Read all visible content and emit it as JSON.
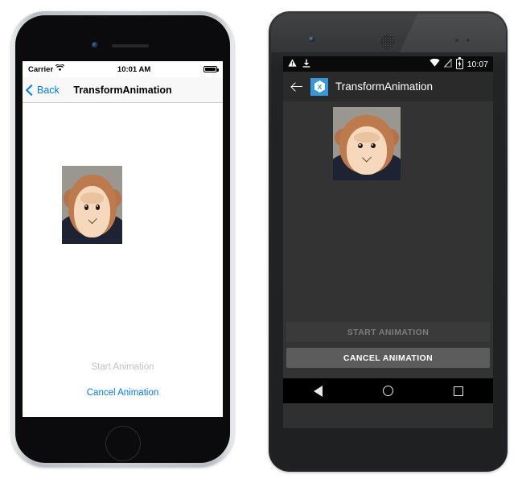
{
  "ios": {
    "status": {
      "carrier": "Carrier",
      "wifi_icon": "wifi-icon",
      "time": "10:01 AM",
      "battery_icon": "battery-full-icon"
    },
    "nav": {
      "back_label": "Back",
      "back_icon": "chevron-left-icon",
      "title": "TransformAnimation",
      "accent": "#007AFF"
    },
    "content": {
      "image_name": "monkey-plush-photo"
    },
    "buttons": [
      {
        "label": "Start Animation",
        "state": "disabled",
        "color": "#c2c2c6"
      },
      {
        "label": "Cancel Animation",
        "state": "enabled",
        "color": "#007AFF"
      }
    ],
    "hardware": {
      "camera": "front-camera",
      "speaker": "earpiece-speaker",
      "home": "home-button"
    }
  },
  "android": {
    "status": {
      "warning_icon": "warning-triangle-icon",
      "download_icon": "download-icon",
      "wifi_icon": "wifi-icon",
      "signal_icon": "signal-off-icon",
      "battery_icon": "battery-charging-icon",
      "time": "10:07"
    },
    "appbar": {
      "back_icon": "arrow-back-icon",
      "logo_icon": "xamarin-logo-icon",
      "logo_letter": "X",
      "title": "TransformAnimation",
      "logo_color": "#3498db"
    },
    "content": {
      "image_name": "monkey-plush-photo"
    },
    "buttons": [
      {
        "label": "START ANIMATION",
        "state": "disabled",
        "bg": "#3a3a3a",
        "color": "#7d7d7d"
      },
      {
        "label": "CANCEL ANIMATION",
        "state": "enabled",
        "bg": "#5c5c5c",
        "color": "#ffffff"
      }
    ],
    "navbar": {
      "back": "nav-back-icon",
      "home": "nav-home-icon",
      "recents": "nav-recents-icon"
    },
    "hardware": {
      "camera": "front-camera",
      "speaker": "earpiece-speaker"
    }
  }
}
